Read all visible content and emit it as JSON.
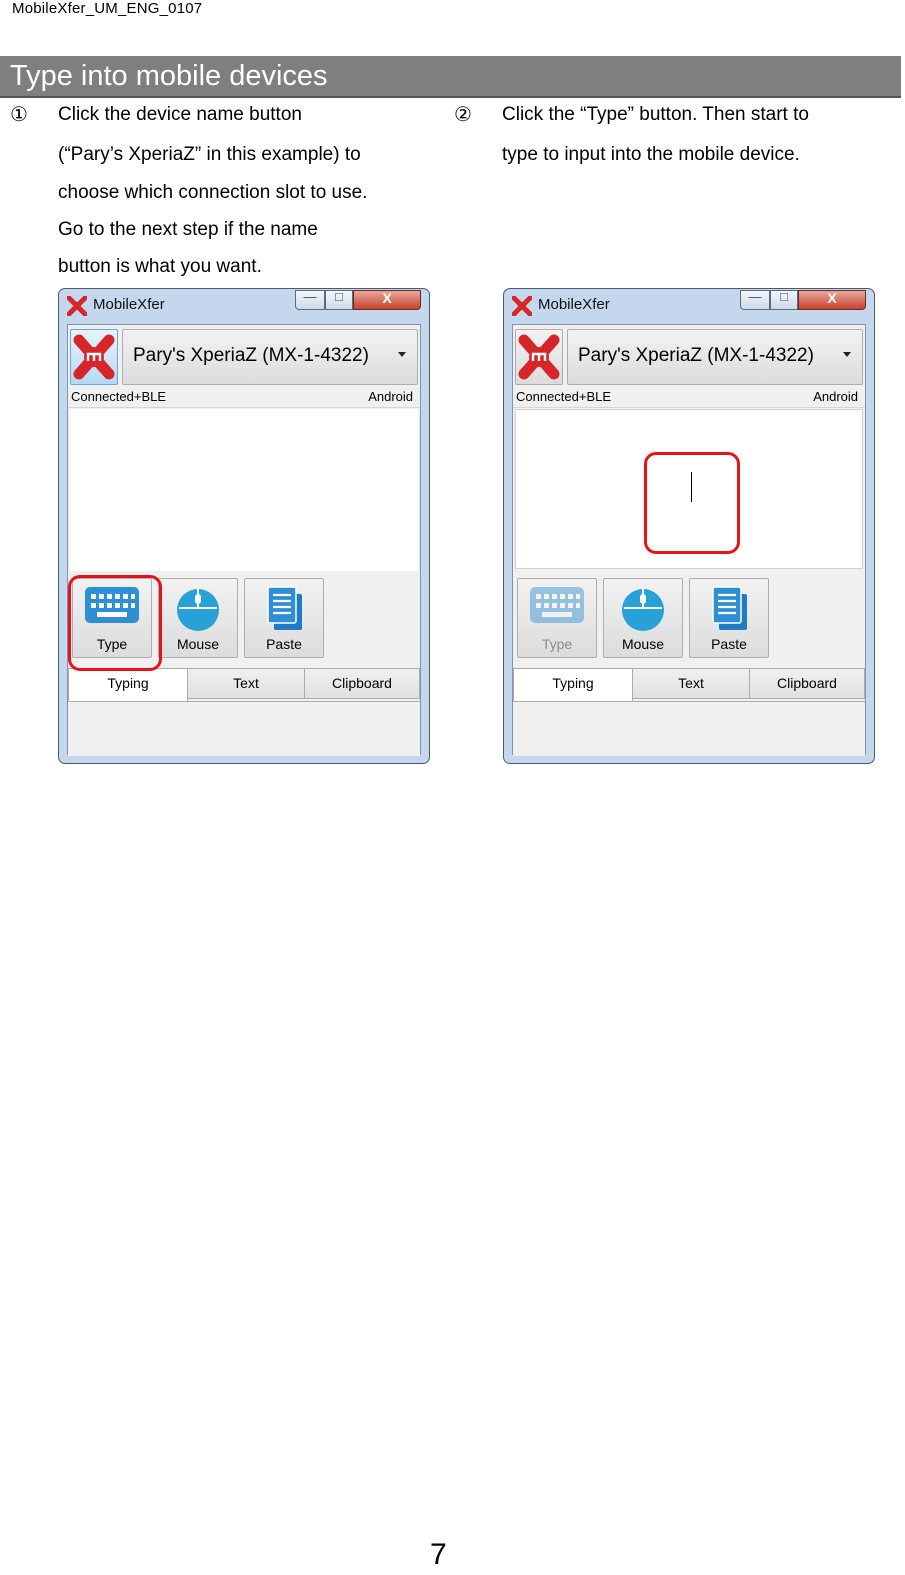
{
  "doc": {
    "header": "MobileXfer_UM_ENG_0107",
    "page_number": "7"
  },
  "section": {
    "title": "Type into mobile devices"
  },
  "steps": [
    {
      "number": "①",
      "lines": [
        "Click the device name button",
        "(“Pary’s XperiaZ” in this example) to",
        "choose which connection slot to use.",
        "Go to the next step if the name",
        "button is what you want."
      ]
    },
    {
      "number": "②",
      "lines": [
        "Click the “Type” button. Then start to",
        "type to input into the mobile device."
      ]
    }
  ],
  "window": {
    "title": "MobileXfer",
    "controls": {
      "minimize": "—",
      "maximize": "□",
      "close": "X"
    },
    "device_name": "Pary's XperiaZ (MX-1-4322)",
    "status_left": "Connected+BLE",
    "status_right": "Android",
    "tool_buttons": [
      "Type",
      "Mouse",
      "Paste"
    ],
    "tabs": [
      "Typing",
      "Text",
      "Clipboard"
    ]
  },
  "colors": {
    "brand": "#d7262a",
    "highlight": "#e8121c",
    "section_bar": "#7f7f7f"
  },
  "icons": {
    "app": "mobilexfer-logo-icon",
    "type": "keyboard-icon",
    "mouse": "mouse-icon",
    "paste": "document-icon"
  }
}
